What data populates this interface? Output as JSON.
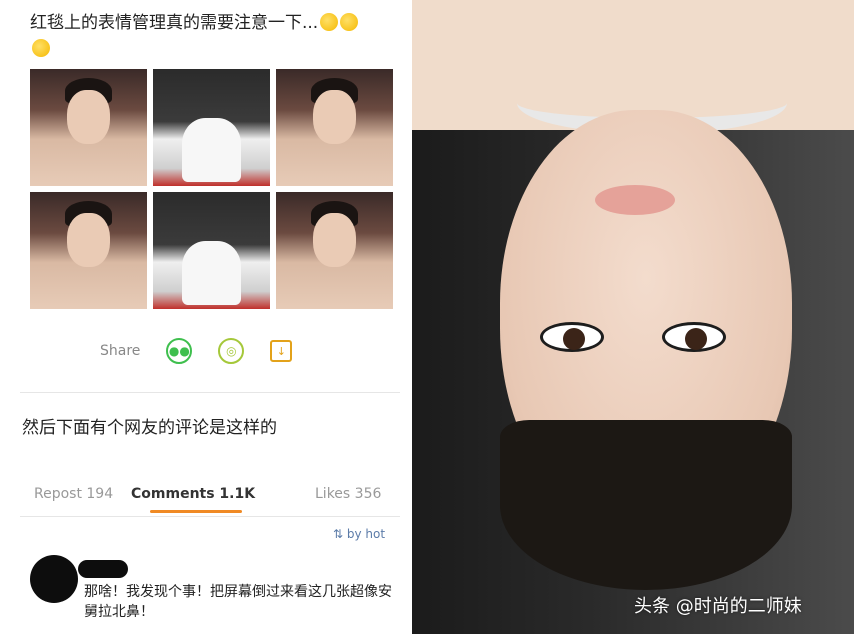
{
  "post": {
    "text": "红毯上的表情管理真的需要注意一下...",
    "emoji_names": [
      "drooling-face-emoji",
      "drooling-face-emoji",
      "drooling-face-emoji"
    ]
  },
  "share": {
    "label": "Share",
    "icons": [
      "wechat-icon",
      "moments-icon",
      "save-image-icon"
    ]
  },
  "middle_text": "然后下面有个网友的评论是这样的",
  "tabs": {
    "repost": "Repost 194",
    "comments": "Comments 1.1K",
    "likes": "Likes 356"
  },
  "sort": {
    "label": "by hot",
    "icon": "sort-icon"
  },
  "comment": {
    "text": "那啥！我发现个事！把屏幕倒过来看这几张超像安舅拉北鼻！"
  },
  "watermark": "头条 @时尚的二师妹",
  "colors": {
    "accent_orange": "#f08a24",
    "link_blue": "#5b7ba8",
    "wechat_green": "#3fbf4e"
  }
}
